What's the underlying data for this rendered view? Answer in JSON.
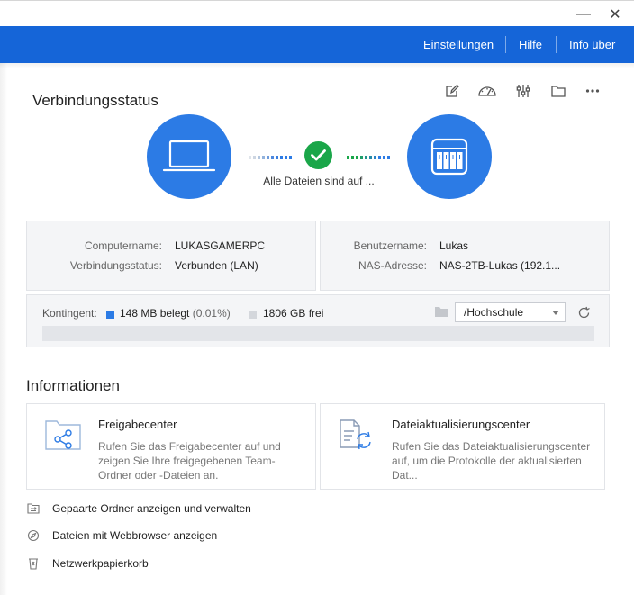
{
  "window": {
    "minimize_glyph": "—",
    "close_glyph": "✕"
  },
  "menu": {
    "settings": "Einstellungen",
    "help": "Hilfe",
    "about": "Info über"
  },
  "connection": {
    "heading": "Verbindungsstatus",
    "status_text": "Alle Dateien sind auf ...",
    "toolbar_icons": [
      "edit-icon",
      "speedometer-icon",
      "sliders-icon",
      "folder-icon",
      "more-icon"
    ]
  },
  "computer": {
    "name_label": "Computername:",
    "name_value": "LUKASGAMERPC",
    "status_label": "Verbindungsstatus:",
    "status_value": "Verbunden (LAN)"
  },
  "nas": {
    "user_label": "Benutzername:",
    "user_value": "Lukas",
    "address_label": "NAS-Adresse:",
    "address_value": "NAS-2TB-Lukas (192.1..."
  },
  "quota": {
    "label": "Kontingent:",
    "used_text": "148 MB belegt",
    "used_pct": "(0.01%)",
    "used_fraction": 0.0001,
    "free_text": "1806  GB frei",
    "folder_value": "/Hochschule"
  },
  "info": {
    "heading": "Informationen",
    "cards": [
      {
        "title": "Freigabecenter",
        "desc": "Rufen Sie das Freigabecenter auf und zeigen Sie Ihre freigegebenen Team-Ordner oder -Dateien an."
      },
      {
        "title": "Dateiaktualisierungscenter",
        "desc": "Rufen Sie das Dateiaktualisierungscenter auf, um die Protokolle der aktualisierten Dat..."
      }
    ],
    "links": [
      "Gepaarte Ordner anzeigen und verwalten",
      "Dateien mit Webbrowser anzeigen",
      "Netzwerkpapierkorb"
    ]
  },
  "colors": {
    "accent": "#1565d8",
    "circle": "#2c7be5",
    "success": "#1aa649"
  }
}
